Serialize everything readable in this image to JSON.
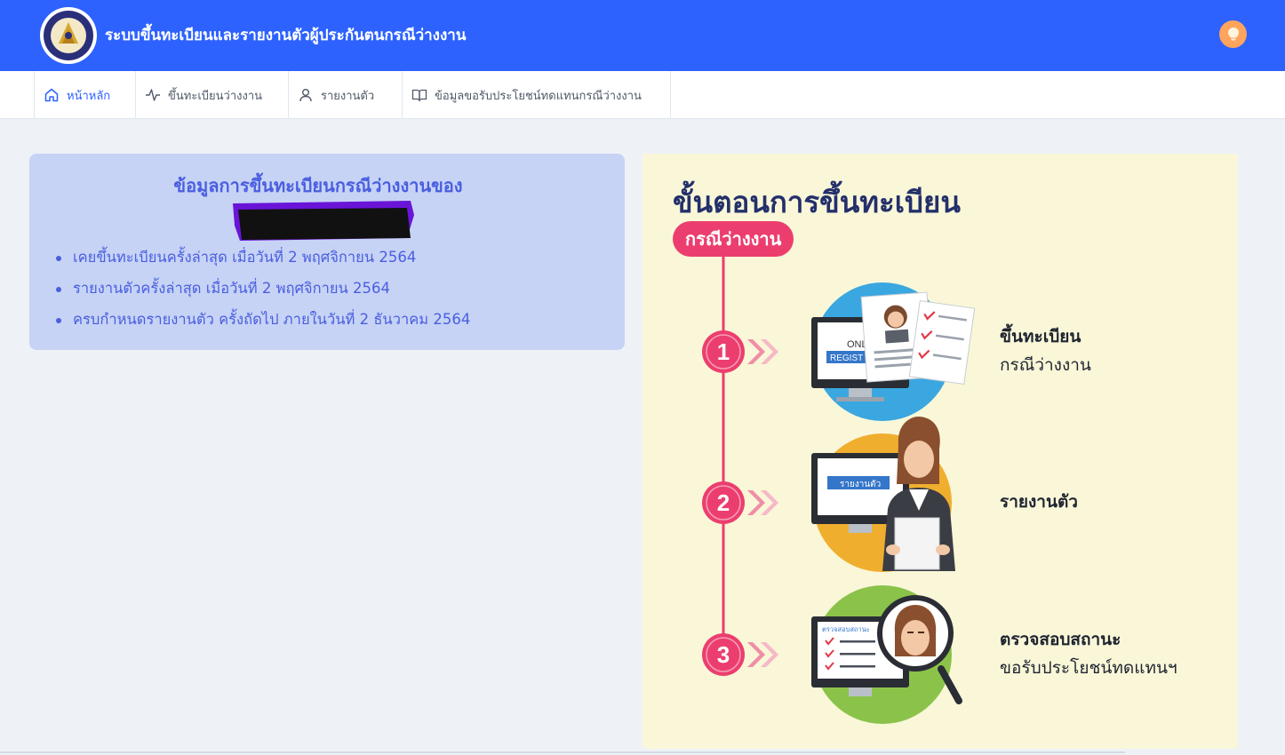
{
  "header": {
    "app_title": "ระบบขึ้นทะเบียนและรายงานตัวผู้ประกันตนกรณีว่างงาน",
    "logo_icon": "department-seal-logo",
    "theme_icon": "lightbulb-icon",
    "brand_color": "#2d62ff"
  },
  "nav": {
    "tabs": [
      {
        "label": "หน้าหลัก",
        "icon": "home-icon",
        "active": true
      },
      {
        "label": "ขึ้นทะเบียนว่างงาน",
        "icon": "activity-icon",
        "active": false
      },
      {
        "label": "รายงานตัว",
        "icon": "user-icon",
        "active": false
      },
      {
        "label": "ข้อมูลขอรับประโยชน์ทดแทนกรณีว่างงาน",
        "icon": "book-icon",
        "active": false
      }
    ]
  },
  "info": {
    "title": "ข้อมูลการขึ้นทะเบียนกรณีว่างงานของ",
    "items": [
      "เคยขึ้นทะเบียนครั้งล่าสุด เมื่อวันที่ 2 พฤศจิกายน 2564",
      "รายงานตัวครั้งล่าสุด เมื่อวันที่ 2 พฤศจิกายน 2564",
      "ครบกำหนดรายงานตัว ครั้งถัดไป ภายในวันที่ 2 ธันวาคม 2564"
    ]
  },
  "steps": {
    "title": "ขั้นตอนการขึ้นทะเบียน",
    "subtitle": "กรณีว่างงาน",
    "items": [
      {
        "number": "1",
        "line1": "ขึ้นทะเบียน",
        "line2": "กรณีว่างงาน",
        "screen_text_a": "ONL",
        "screen_text_b": "REGIST"
      },
      {
        "number": "2",
        "line1": "รายงานตัว",
        "line2": "",
        "screen_text_a": "รายงานตัว"
      },
      {
        "number": "3",
        "line1": "ตรวจสอบสถานะ",
        "line2": "ขอรับประโยชน์ทดแทนฯ",
        "screen_text_a": "ตรวจสอบสถานะ"
      }
    ]
  }
}
